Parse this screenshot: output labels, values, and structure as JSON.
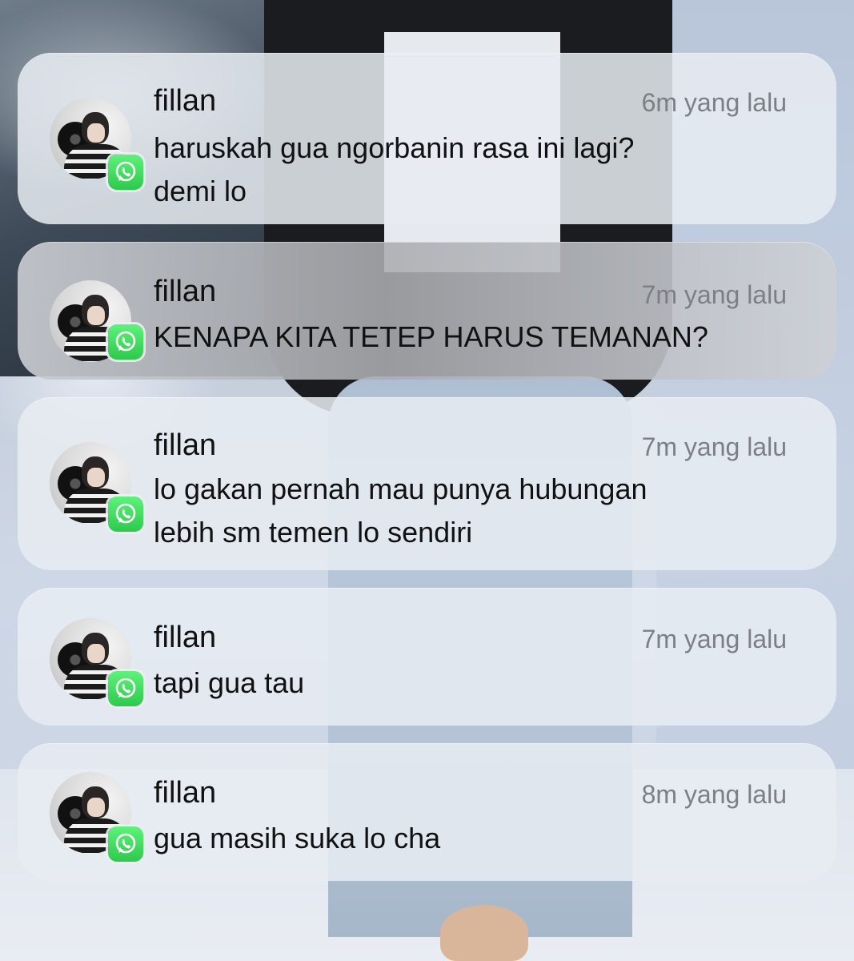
{
  "notifications": [
    {
      "sender": "fillan",
      "time": "6m yang lalu",
      "message_lines": [
        "haruskah gua ngorbanin rasa ini lagi?",
        "demi lo"
      ],
      "app_icon": "whatsapp-icon"
    },
    {
      "sender": "fillan",
      "time": "7m yang lalu",
      "message_lines": [
        "KENAPA KITA TETEP HARUS TEMANAN?"
      ],
      "app_icon": "whatsapp-icon"
    },
    {
      "sender": "fillan",
      "time": "7m yang lalu",
      "message_lines": [
        "lo gakan pernah mau punya hubungan",
        "lebih sm temen lo sendiri"
      ],
      "app_icon": "whatsapp-icon"
    },
    {
      "sender": "fillan",
      "time": "7m yang lalu",
      "message_lines": [
        "tapi gua tau"
      ],
      "app_icon": "whatsapp-icon"
    },
    {
      "sender": "fillan",
      "time": "8m yang lalu",
      "message_lines": [
        "gua masih suka lo cha"
      ],
      "app_icon": "whatsapp-icon"
    }
  ],
  "colors": {
    "whatsapp_green": "#2dc94c",
    "time_text": "#7c7f85",
    "card_background": "#e8ecf2"
  }
}
